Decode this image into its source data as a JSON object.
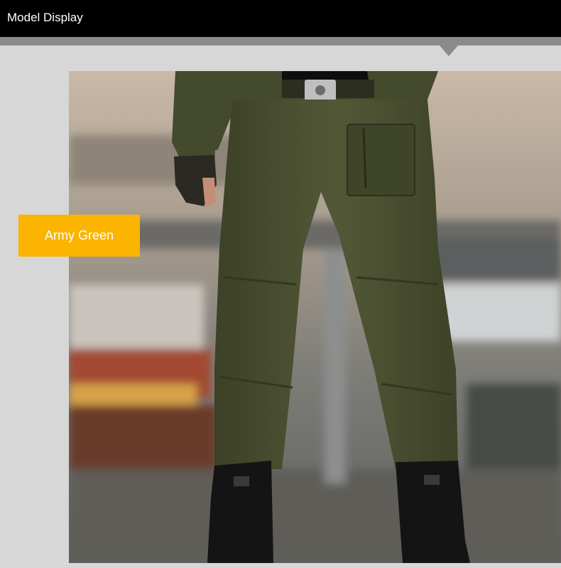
{
  "header": {
    "title": "Model Display"
  },
  "product": {
    "color_label": "Army Green"
  },
  "colors": {
    "header_bg": "#000000",
    "header_bar": "#8b8b8b",
    "page_bg": "#d7d7d7",
    "tag_bg": "#fbb400",
    "pants": "#4a4f30"
  },
  "icons": {
    "notch": "triangle-down"
  }
}
